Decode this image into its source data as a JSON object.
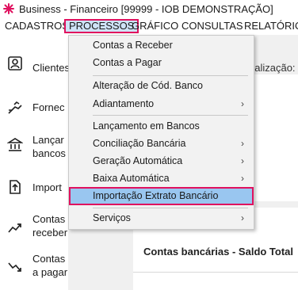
{
  "window": {
    "title": "Business - Financeiro  [99999 - IOB DEMONSTRAÇÃO]"
  },
  "menubar": {
    "items": [
      "CADASTROS",
      "PROCESSOS",
      "GRÁFICO",
      "CONSULTAS",
      "RELATÓRIOS"
    ],
    "active": "PROCESSOS"
  },
  "sidebar": {
    "items": [
      {
        "label": "Clientes",
        "icon": "client-icon"
      },
      {
        "label": "Fornec",
        "icon": "supplier-handshake-icon"
      },
      {
        "label": "Lançar\nbancos",
        "icon": "bank-icon"
      },
      {
        "label": "Import",
        "icon": "import-icon"
      },
      {
        "label": "Contas\nreceber",
        "icon": "trend-up-icon"
      },
      {
        "label": "Contas\na pagar",
        "icon": "trend-down-icon"
      }
    ]
  },
  "content": {
    "update_label": "ualização:",
    "bottom_panel_title": "Contas bancárias - Saldo Total"
  },
  "processos_menu": {
    "items": [
      {
        "label": "Contas a Receber",
        "submenu": false
      },
      {
        "label": "Contas a Pagar",
        "submenu": false
      },
      {
        "label": "Alteração de Cód. Banco",
        "submenu": false
      },
      {
        "label": "Adiantamento",
        "submenu": true
      },
      {
        "label": "Lançamento em Bancos",
        "submenu": false
      },
      {
        "label": "Conciliação Bancária",
        "submenu": true
      },
      {
        "label": "Geração Automática",
        "submenu": true
      },
      {
        "label": "Baixa Automática",
        "submenu": true
      },
      {
        "label": "Importação Extrato Bancário",
        "submenu": false,
        "highlighted": true
      },
      {
        "label": "Serviços",
        "submenu": true
      }
    ],
    "submenu_arrow": "›"
  },
  "colors": {
    "highlight_border": "#e0115f",
    "highlight_fill": "#99c6f0",
    "app_icon": "#e0115f"
  }
}
